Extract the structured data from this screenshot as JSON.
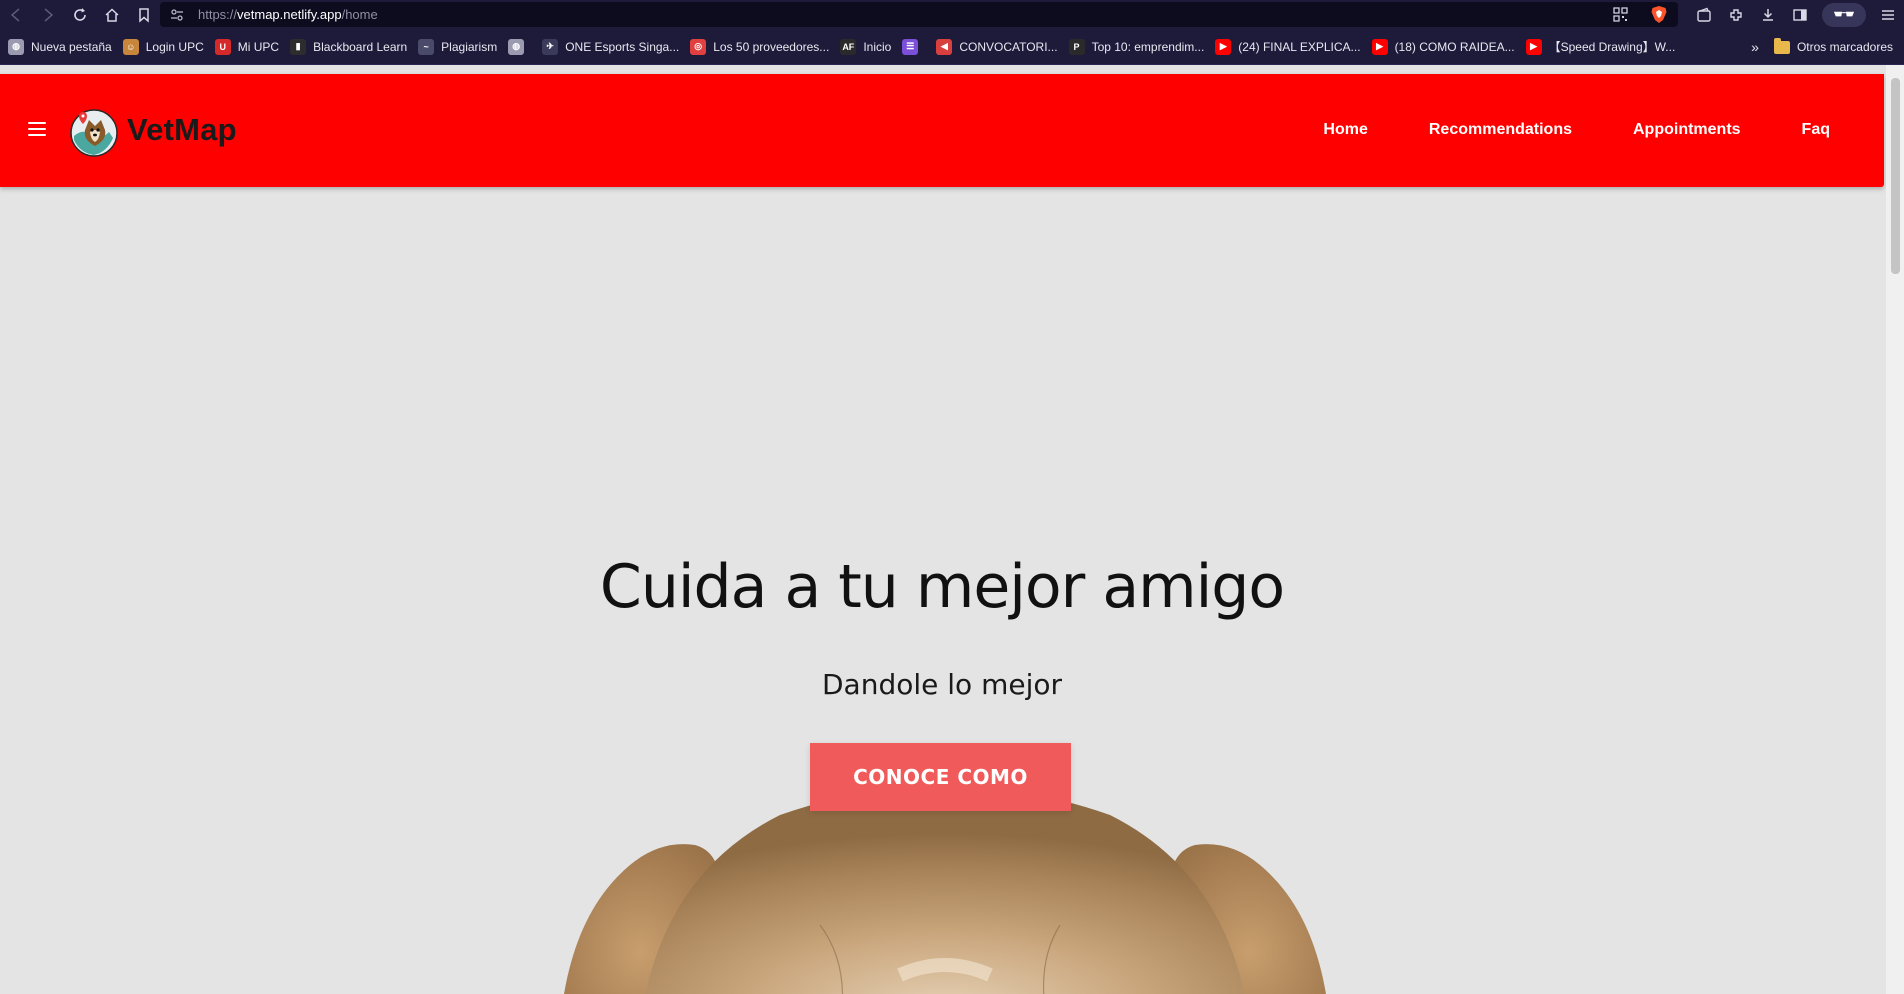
{
  "browser": {
    "url_scheme": "https://",
    "url_host": "vetmap.netlify.app",
    "url_path": "/home",
    "bookmarks": [
      {
        "label": "Nueva pestaña",
        "icon": "globe-icon",
        "color": "#9a9ab0"
      },
      {
        "label": "Login UPC",
        "icon": "avatar-icon",
        "color": "#c8863c"
      },
      {
        "label": "Mi UPC",
        "icon": "upc-icon",
        "color": "#d62a2a"
      },
      {
        "label": "Blackboard Learn",
        "icon": "blackboard-icon",
        "color": "#2d2d2d"
      },
      {
        "label": "Plagiarism",
        "icon": "plagiarism-icon",
        "color": "#4a4a6a"
      },
      {
        "label": "",
        "icon": "globe-icon",
        "color": "#9a9ab0"
      },
      {
        "label": "ONE Esports Singa...",
        "icon": "one-esports-icon",
        "color": "#3a3a5a"
      },
      {
        "label": "Los 50 proveedores...",
        "icon": "target-icon",
        "color": "#e04040"
      },
      {
        "label": "Inicio",
        "icon": "af-icon",
        "color": "#2a2a2a"
      },
      {
        "label": "",
        "icon": "list-icon",
        "color": "#7b4fd8"
      },
      {
        "label": "CONVOCATORI...",
        "icon": "megaphone-icon",
        "color": "#d84040"
      },
      {
        "label": "Top 10: emprendim...",
        "icon": "p-icon",
        "color": "#2a2a2a"
      },
      {
        "label": "(24) FINAL EXPLICA...",
        "icon": "youtube-icon",
        "color": "#ff0000"
      },
      {
        "label": "(18) COMO RAIDEA...",
        "icon": "youtube-icon",
        "color": "#ff0000"
      },
      {
        "label": "【Speed Drawing】W...",
        "icon": "youtube-icon",
        "color": "#ff0000"
      }
    ],
    "more_chevron": "»",
    "other_bookmarks": "Otros marcadores"
  },
  "navbar": {
    "brand": "VetMap",
    "bg_color": "#ff0000",
    "links": [
      "Home",
      "Recommendations",
      "Appointments",
      "Faq"
    ]
  },
  "hero": {
    "title": "Cuida a tu mejor amigo",
    "subtitle": "Dandole lo mejor",
    "cta_label": "CONOCE COMO",
    "cta_color": "#f05a5a"
  }
}
